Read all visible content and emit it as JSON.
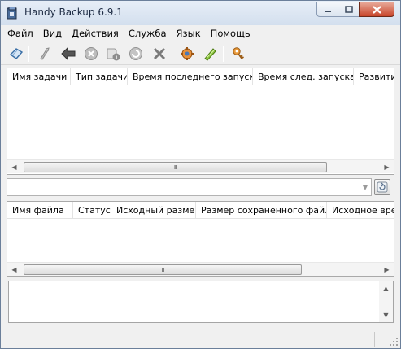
{
  "window": {
    "title": "Handy Backup 6.9.1"
  },
  "menu": [
    "Файл",
    "Вид",
    "Действия",
    "Служба",
    "Язык",
    "Помощь"
  ],
  "toolbar": {
    "buttons": [
      "new-task-icon",
      "edit-icon",
      "back-arrow-icon",
      "stop-icon",
      "task-info-icon",
      "restore-icon",
      "tools-icon",
      "settings-gear-icon",
      "run-icon",
      "key-icon"
    ]
  },
  "tasks_table": {
    "columns": [
      "Имя задачи",
      "Тип задачи",
      "Время последнего запуска",
      "Время след. запуска",
      "Развити"
    ],
    "rows": []
  },
  "files_table": {
    "columns": [
      "Имя файла",
      "Статус",
      "Исходный размер",
      "Размер сохраненного файла",
      "Исходное врем"
    ],
    "rows": []
  },
  "scroll_grip": "III",
  "combo": {
    "value": ""
  },
  "log": {
    "text": ""
  },
  "statusbar": {
    "text": ""
  }
}
